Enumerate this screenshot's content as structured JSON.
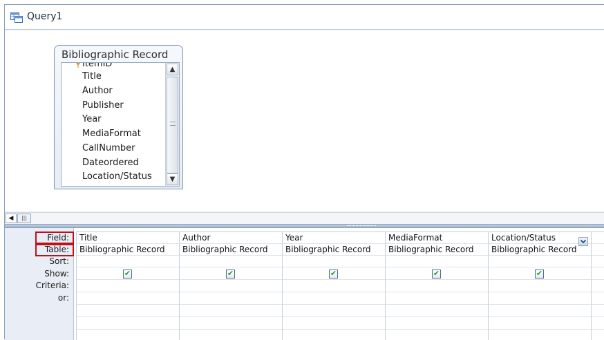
{
  "window": {
    "title": "Query1"
  },
  "icons": {
    "query": "query-icon",
    "key": "primary-key-icon"
  },
  "table_box": {
    "title": "Bibliographic Record",
    "fields": [
      "ItemID",
      "Title",
      "Author",
      "Publisher",
      "Year",
      "MediaFormat",
      "CallNumber",
      "Dateordered",
      "Location/Status"
    ]
  },
  "grid": {
    "row_labels": [
      "Field:",
      "Table:",
      "Sort:",
      "Show:",
      "Criteria:",
      "or:"
    ],
    "columns": [
      {
        "field": "Title",
        "table": "Bibliographic Record",
        "show": true
      },
      {
        "field": "Author",
        "table": "Bibliographic Record",
        "show": true
      },
      {
        "field": "Year",
        "table": "Bibliographic Record",
        "show": true
      },
      {
        "field": "MediaFormat",
        "table": "Bibliographic Record",
        "show": true
      },
      {
        "field": "Location/Status",
        "table": "Bibliographic Record",
        "show": true
      }
    ],
    "checkmark": "✔"
  },
  "colors": {
    "highlight": "#c0101a",
    "check": "#2f9a2b"
  }
}
